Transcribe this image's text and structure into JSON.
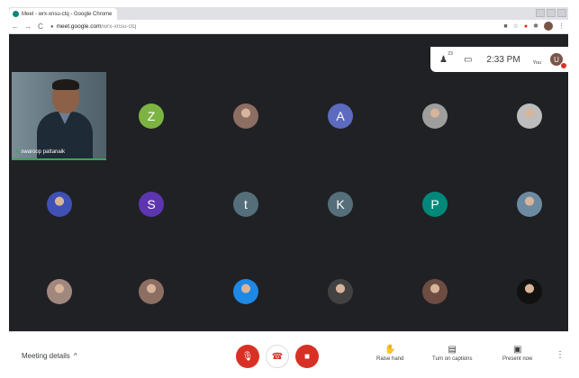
{
  "browser": {
    "tab_title": "Meet - wrx-xnsu-ctq - Google Chrome",
    "url_host": "meet.google.com",
    "url_path": "/wrx-xnsu-ctq"
  },
  "meet": {
    "people_count": "23",
    "time": "2:33 PM",
    "you_label": "You",
    "you_initial": "U",
    "presenter_name": "swaroop pattanaik",
    "participants": [
      {
        "letter": "Z",
        "color": "#7cb342"
      },
      {
        "letter": "",
        "color": "#8d6e63"
      },
      {
        "letter": "A",
        "color": "#5c6bc0"
      },
      {
        "letter": "",
        "color": "#9e9e9e"
      },
      {
        "letter": "",
        "color": "#bdbdbd"
      },
      {
        "letter": "",
        "color": "#3f51b5"
      },
      {
        "letter": "S",
        "color": "#5e35b1"
      },
      {
        "letter": "t",
        "color": "#546e7a"
      },
      {
        "letter": "K",
        "color": "#546e7a"
      },
      {
        "letter": "P",
        "color": "#00897b"
      },
      {
        "letter": "",
        "color": "#6d8aa3"
      },
      {
        "letter": "",
        "color": "#a1887f"
      },
      {
        "letter": "",
        "color": "#8d6e63"
      },
      {
        "letter": "",
        "color": "#1e88e5"
      },
      {
        "letter": "",
        "color": "#424242"
      },
      {
        "letter": "",
        "color": "#6d4c41"
      },
      {
        "letter": "",
        "color": "#111111"
      }
    ]
  },
  "controls": {
    "meeting_details": "Meeting details",
    "raise_hand": "Raise hand",
    "turn_on_captions": "Turn on captions",
    "present_now": "Present now"
  }
}
